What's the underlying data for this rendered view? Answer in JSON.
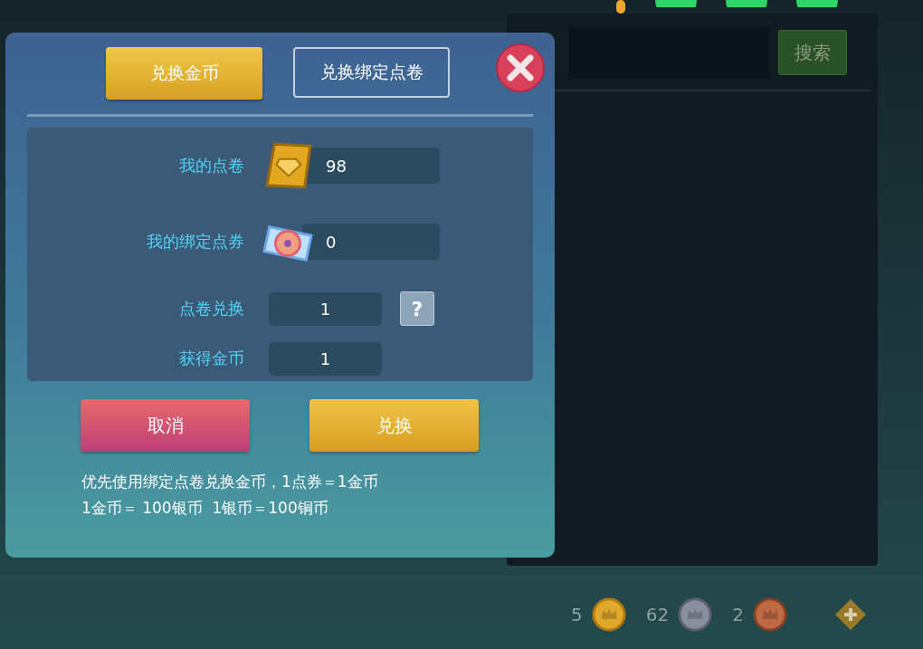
{
  "tabs": [
    {
      "label": "兑换金币",
      "selected": true
    },
    {
      "label": "兑换绑定点卷",
      "selected": false
    }
  ],
  "balances": [
    {
      "label": "我的点卷",
      "kind": "gold",
      "value": "98"
    },
    {
      "label": "我的绑定点券",
      "kind": "bound",
      "value": "0"
    }
  ],
  "exchange": {
    "label": "点卷兑换",
    "value": "1",
    "help": "?"
  },
  "result": {
    "label": "获得金币",
    "value": "1"
  },
  "buttons": [
    {
      "label": "取消",
      "kind": "cancel"
    },
    {
      "label": "兑换",
      "kind": "confirm"
    }
  ],
  "notes": [
    "优先使用绑定点卷兑换金币，1点券＝1金币",
    "1金币＝ 100银币  1银币＝100铜币"
  ],
  "search": {
    "button": "搜索"
  },
  "currencies": [
    {
      "amount": "5",
      "kind": "gold"
    },
    {
      "amount": "62",
      "kind": "silver"
    },
    {
      "amount": "2",
      "kind": "copper"
    }
  ]
}
